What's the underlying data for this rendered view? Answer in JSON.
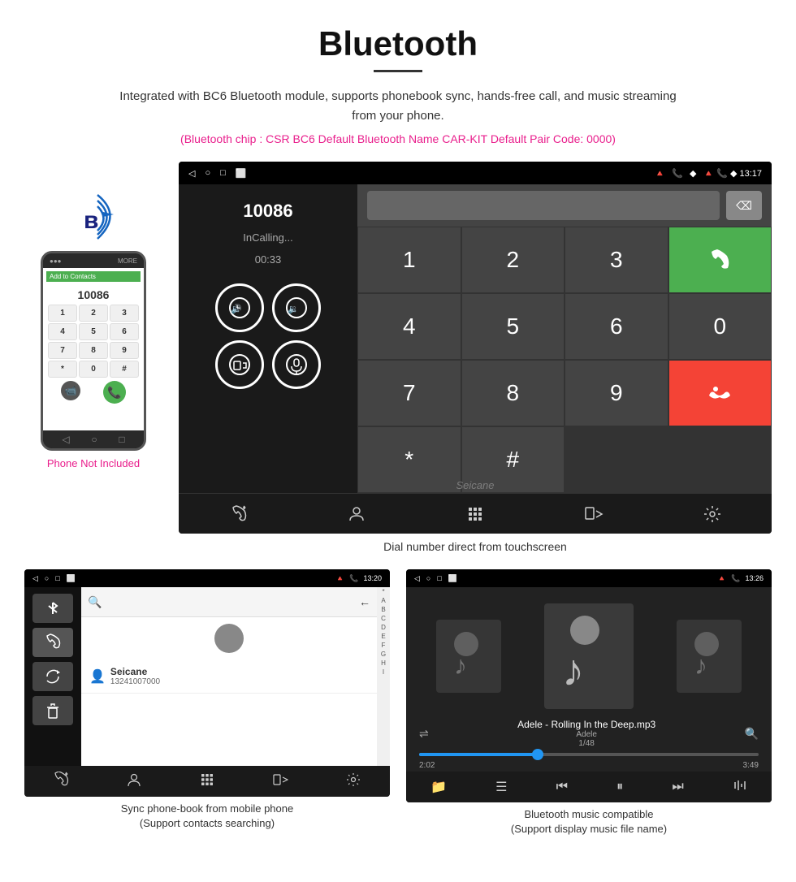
{
  "page": {
    "title": "Bluetooth",
    "title_underline": true,
    "description": "Integrated with BC6 Bluetooth module, supports phonebook sync, hands-free call, and music streaming from your phone.",
    "specs": "(Bluetooth chip : CSR BC6    Default Bluetooth Name CAR-KIT    Default Pair Code: 0000)"
  },
  "phone_mockup": {
    "not_included": "Phone Not Included",
    "add_to_contacts": "Add to Contacts",
    "keys": [
      "1",
      "2",
      "3",
      "4",
      "5",
      "6",
      "7",
      "8",
      "9",
      "*",
      "0",
      "#"
    ],
    "more_label": "MORE"
  },
  "main_screen": {
    "status_bar": {
      "nav_symbols": [
        "◁",
        "○",
        "□",
        "⬜"
      ],
      "right": "🔺 📞 ◆ 13:17"
    },
    "called_number": "10086",
    "call_status": "InCalling...",
    "call_timer": "00:33",
    "dialpad_keys": [
      "1",
      "2",
      "3",
      "*",
      "4",
      "5",
      "6",
      "0",
      "7",
      "8",
      "9",
      "#"
    ],
    "green_call_icon": "📞",
    "red_call_icon": "📞",
    "bottom_icons": [
      "📞",
      "👤",
      "⊞",
      "📱",
      "⚙"
    ],
    "caption": "Dial number direct from touchscreen",
    "watermark": "Seicane"
  },
  "phonebook_screen": {
    "status_bar": {
      "left_nav": [
        "◁",
        "○",
        "□",
        "⬜"
      ],
      "right": "🔺 📞 13:20"
    },
    "sidebar_icons": [
      "bluetooth",
      "phone",
      "refresh",
      "trash"
    ],
    "contact_name": "Seicane",
    "contact_number": "13241007000",
    "alpha_letters": [
      "*",
      "A",
      "B",
      "C",
      "D",
      "E",
      "F",
      "G",
      "H",
      "I"
    ],
    "bottom_icons": [
      "📞",
      "👤",
      "⊞",
      "📱",
      "⚙"
    ],
    "caption_line1": "Sync phone-book from mobile phone",
    "caption_line2": "(Support contacts searching)"
  },
  "music_screen": {
    "status_bar": {
      "left_nav": [
        "◁",
        "○",
        "□",
        "⬜"
      ],
      "right": "🔺 📞 13:26"
    },
    "song_title": "Adele - Rolling In the Deep.mp3",
    "artist": "Adele",
    "track_info": "1/48",
    "time_current": "2:02",
    "time_total": "3:49",
    "progress_percent": 35,
    "bottom_icons": [
      "shuffle",
      "list",
      "prev",
      "play",
      "next",
      "eq"
    ],
    "caption_line1": "Bluetooth music compatible",
    "caption_line2": "(Support display music file name)"
  }
}
